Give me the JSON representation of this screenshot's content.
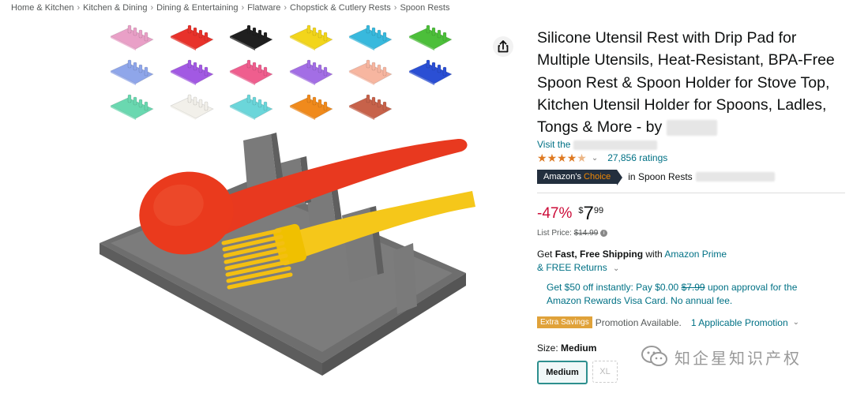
{
  "breadcrumb": [
    "Home & Kitchen",
    "Kitchen & Dining",
    "Dining & Entertaining",
    "Flatware",
    "Chopstick & Cutlery Rests",
    "Spoon Rests"
  ],
  "swatch_colors": [
    "#e9a0c7",
    "#e8322b",
    "#1f1f1f",
    "#f2d51b",
    "#38b9dd",
    "#4cbf3a",
    "#8fa6ea",
    "#a259e3",
    "#ef5e8e",
    "#a36ee5",
    "#f7b6a0",
    "#2b4fd4",
    "#6ad8b0",
    "#f2f0ea",
    "#6bd6da",
    "#f08a1c",
    "#c7624a"
  ],
  "product": {
    "title": "Silicone Utensil Rest with Drip Pad for Multiple Utensils, Heat-Resistant, BPA-Free Spoon Rest & Spoon Holder for Stove Top, Kitchen Utensil Holder for Spoons, Ladles, Tongs & More - by",
    "store_prefix": "Visit the",
    "rating_count": "27,856 ratings",
    "star_rating": 4.5,
    "choice_badge_1": "Amazon's",
    "choice_badge_2": "Choice",
    "choice_category": "in Spoon Rests",
    "discount": "-47%",
    "currency": "$",
    "price_whole": "7",
    "price_fraction": "99",
    "list_price_label": "List Price:",
    "list_price": "$14.99",
    "shipping_1": "Get",
    "shipping_bold": "Fast, Free Shipping",
    "shipping_2": "with",
    "shipping_link": "Amazon Prime",
    "returns": "& FREE Returns",
    "promo_1": "Get $50 off instantly: Pay $0.00",
    "promo_strike": "$7.99",
    "promo_2": "upon approval for the Amazon Rewards Visa Card. No annual fee.",
    "extra_savings": "Extra Savings",
    "promo_available": "Promotion Available.",
    "applicable": "1 Applicable Promotion",
    "size_label": "Size:",
    "size_value": "Medium",
    "sizes": [
      "Medium",
      "XL"
    ]
  },
  "watermark": "知企星知识产权",
  "icons": {
    "share": "share-icon",
    "chevron": "chevron-down-icon",
    "info": "info-icon",
    "wechat": "wechat-icon"
  }
}
